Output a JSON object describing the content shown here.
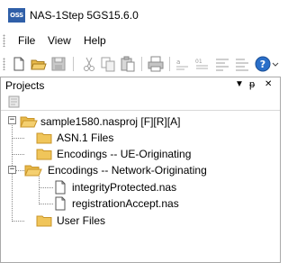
{
  "window": {
    "icon_text": "OSS",
    "title": "NAS-1Step 5GS15.6.0"
  },
  "menu": {
    "items": [
      {
        "label": "File"
      },
      {
        "label": "View"
      },
      {
        "label": "Help"
      }
    ]
  },
  "toolbar": {
    "buttons": [
      {
        "icon": "new-file-icon"
      },
      {
        "icon": "open-folder-icon"
      },
      {
        "icon": "save-icon"
      },
      {
        "icon": "cut-icon"
      },
      {
        "icon": "copy-icon"
      },
      {
        "icon": "paste-icon"
      },
      {
        "icon": "print-icon"
      },
      {
        "icon": "encode-icon"
      },
      {
        "icon": "decode-icon"
      },
      {
        "icon": "format-icon"
      },
      {
        "icon": "check-icon"
      },
      {
        "icon": "help-icon"
      }
    ]
  },
  "projects_pane": {
    "title": "Projects",
    "controls": {
      "dropdown": "▼",
      "pin": "ᵽ",
      "close": "✕"
    }
  },
  "tree": {
    "root": {
      "label": "sample1580.nasproj [F][R][A]",
      "expanded": true
    },
    "children": [
      {
        "label": "ASN.1 Files",
        "type": "folder"
      },
      {
        "label": "Encodings -- UE-Originating",
        "type": "folder"
      },
      {
        "label": "Encodings -- Network-Originating",
        "type": "folder",
        "expanded": true,
        "files": [
          {
            "label": "integrityProtected.nas",
            "type": "file"
          },
          {
            "label": "registrationAccept.nas",
            "type": "file"
          }
        ]
      },
      {
        "label": "User Files",
        "type": "folder"
      }
    ]
  },
  "colors": {
    "folder": "#e8b94a",
    "folder_dark": "#c99528",
    "app_icon": "#2f5fa8",
    "help_blue": "#2a6fc9"
  }
}
